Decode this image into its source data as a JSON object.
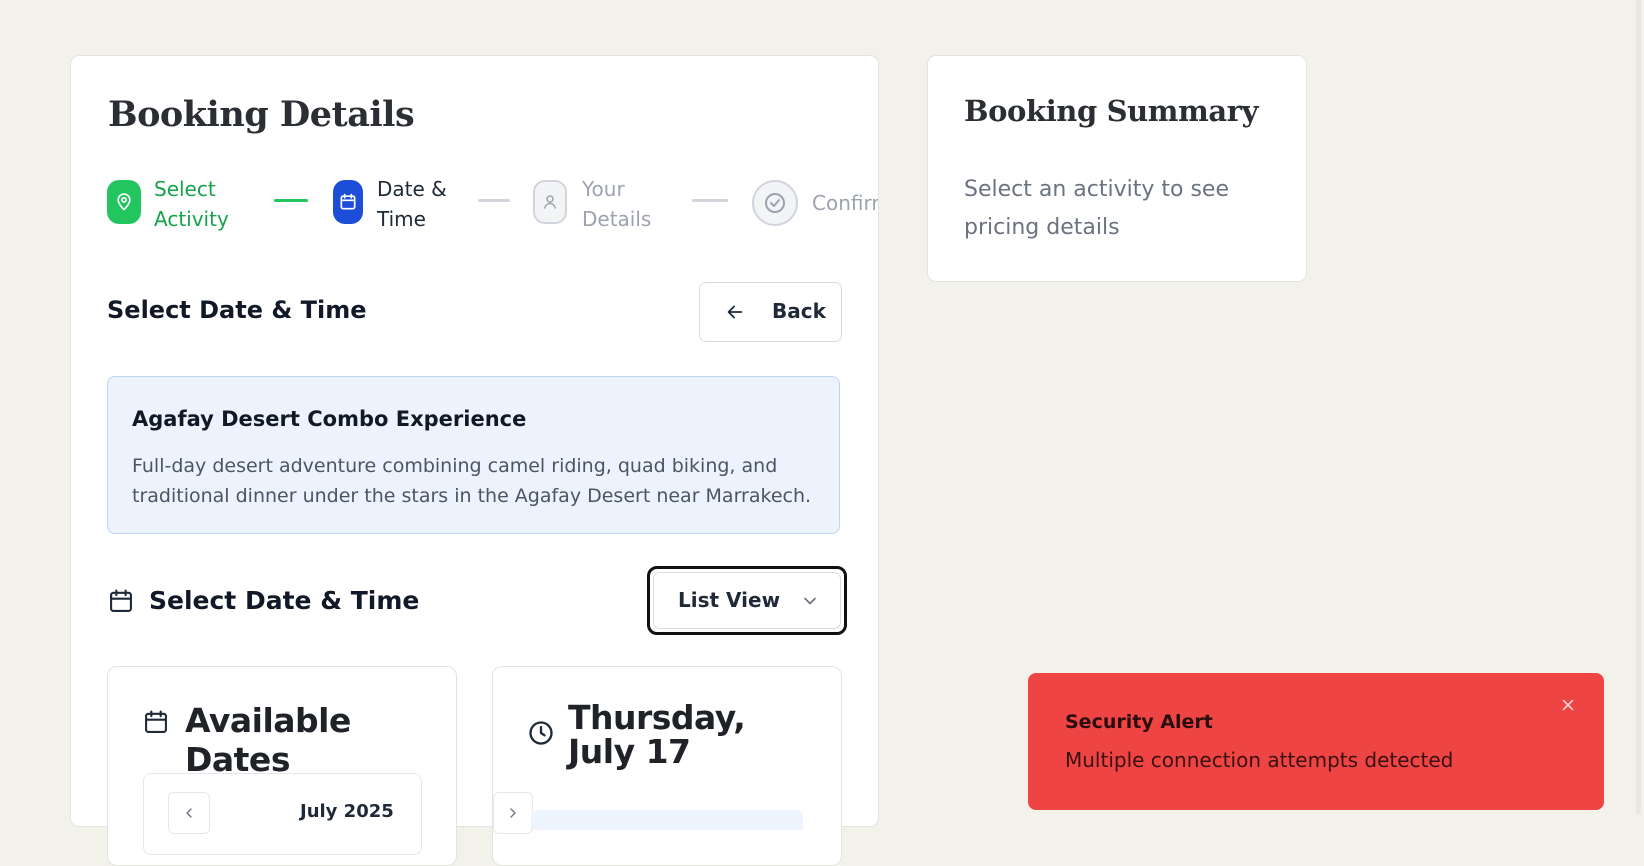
{
  "main": {
    "title": "Booking Details",
    "steps": [
      {
        "label_line1": "Select",
        "label_line2": "Activity",
        "state": "completed",
        "icon": "map-pin-icon"
      },
      {
        "label_line1": "Date &",
        "label_line2": "Time",
        "state": "current",
        "icon": "calendar-icon"
      },
      {
        "label_line1": "Your",
        "label_line2": "Details",
        "state": "upcoming",
        "icon": "user-icon"
      },
      {
        "label_line1": "Confirmation",
        "label_line2": "",
        "state": "upcoming",
        "icon": "check-circle-icon"
      }
    ],
    "section_title": "Select Date & Time",
    "back_label": "Back",
    "activity": {
      "title": "Agafay Desert Combo Experience",
      "description": "Full-day desert adventure combining camel riding, quad biking, and traditional dinner under the stars in the Agafay Desert near Marrakech."
    },
    "picker": {
      "title": "Select Date & Time",
      "view_select_value": "List View",
      "available_dates_title": "Available Dates",
      "month_label": "July 2025",
      "selected_day_title": "Thursday, July 17"
    }
  },
  "summary": {
    "title": "Booking Summary",
    "text": "Select an activity to see pricing details"
  },
  "toast": {
    "title": "Security Alert",
    "message": "Multiple connection attempts detected"
  },
  "colors": {
    "green": "#22c55e",
    "blue": "#1d4ed8",
    "gray": "#9ca3af",
    "toast_red": "#ef4444",
    "background": "#f3f2ea"
  }
}
